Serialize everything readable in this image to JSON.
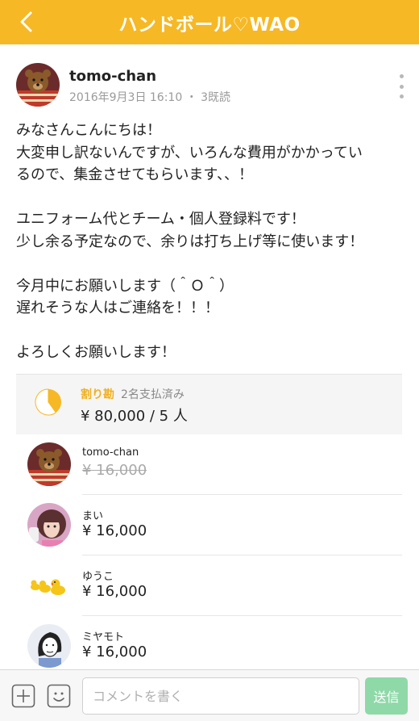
{
  "header": {
    "title": "ハンドボール♡WAO"
  },
  "post": {
    "author": "tomo-chan",
    "meta": "2016年9月3日 16:10 ・ 3既読",
    "body_lines": [
      "みなさんこんにちは！",
      "大変申し訳ないんですが、いろんな費用がかかってい",
      "るので、集金させてもらいます、、！",
      "",
      "ユニフォーム代とチーム・個人登録料です！",
      "少し余る予定なので、余りは打ち上げ等に使います！",
      "",
      "今月中にお願いします（＾Ｏ＾）",
      "遅れそうな人はご連絡を！！！",
      "",
      "よろしくお願いします！"
    ]
  },
  "split": {
    "label": "割り勘",
    "paid_status": "2名支払済み",
    "total": "¥ 80,000 / 5 人",
    "paid_fraction": 0.4,
    "accent_color": "#f6b825"
  },
  "payers": [
    {
      "name": "tomo-chan",
      "amount": "¥ 16,000",
      "paid": true,
      "avatar": "teddy-bear-avatar"
    },
    {
      "name": "まい",
      "amount": "¥ 16,000",
      "paid": false,
      "avatar": "girl-portrait-avatar"
    },
    {
      "name": "ゆうこ",
      "amount": "¥ 16,000",
      "paid": false,
      "avatar": "rubber-ducks-avatar"
    },
    {
      "name": "ミヤモト",
      "amount": "¥ 16,000",
      "paid": false,
      "avatar": "sketch-portrait-avatar"
    }
  ],
  "composer": {
    "placeholder": "コメントを書く",
    "send_label": "送信"
  }
}
